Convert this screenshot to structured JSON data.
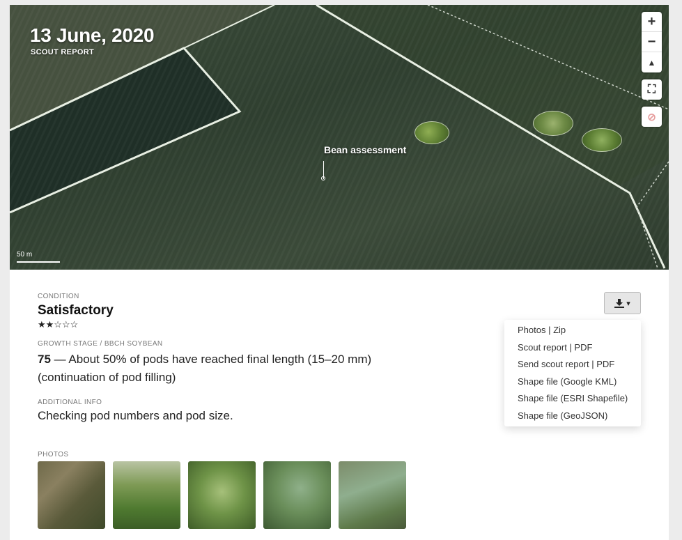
{
  "map": {
    "date": "13 June, 2020",
    "subtitle": "SCOUT REPORT",
    "marker_label": "Bean assessment",
    "scale_label": "50 m",
    "controls": {
      "zoom_in": "+",
      "zoom_out": "−",
      "compass": "▲",
      "fullscreen": "⛶",
      "toggle_layer": "⊘"
    }
  },
  "condition": {
    "label": "CONDITION",
    "value": "Satisfactory",
    "stars": "★★☆☆☆",
    "rating": 2,
    "max_rating": 5
  },
  "growth_stage": {
    "label": "GROWTH STAGE / BBCH SOYBEAN",
    "code": "75",
    "description": " — About 50% of pods have reached final length (15–20 mm) (continuation of pod filling)"
  },
  "additional_info": {
    "label": "ADDITIONAL INFO",
    "text": "Checking pod numbers and pod size."
  },
  "photos": {
    "label": "PHOTOS",
    "count": 5
  },
  "download": {
    "button_icon": "download-icon",
    "caret": "▾",
    "menu": [
      "Photos | Zip",
      "Scout report | PDF",
      "Send scout report | PDF",
      "Shape file (Google KML)",
      "Shape file (ESRI Shapefile)",
      "Shape file (GeoJSON)"
    ]
  }
}
